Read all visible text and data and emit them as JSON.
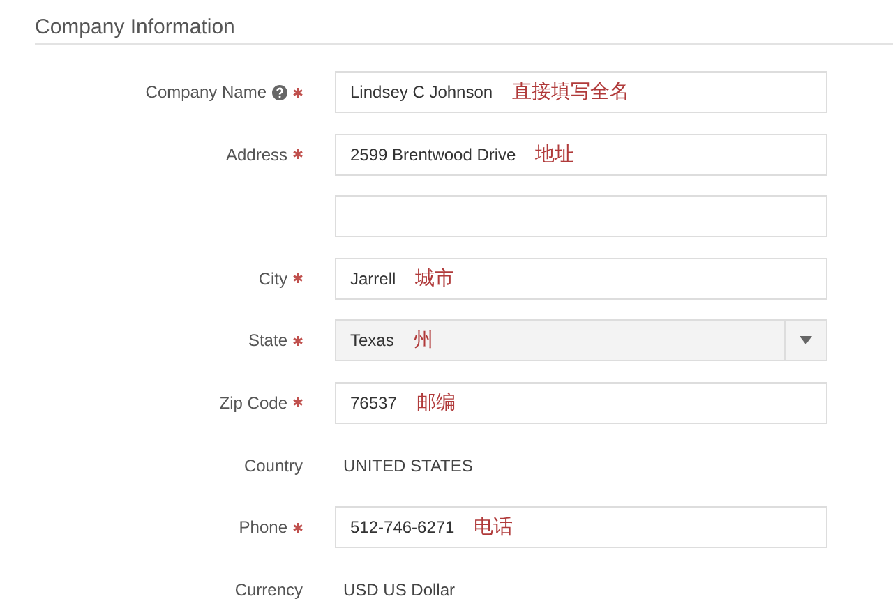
{
  "section": {
    "title": "Company Information"
  },
  "fields": [
    {
      "kind": "input",
      "label": "Company Name",
      "help": true,
      "required": true,
      "value": "Lindsey C Johnson",
      "annotation": "直接填写全名"
    },
    {
      "kind": "input",
      "label": "Address",
      "required": true,
      "value": "2599 Brentwood Drive",
      "annotation": "地址"
    },
    {
      "kind": "input"
    },
    {
      "kind": "input",
      "label": "City",
      "required": true,
      "value": "Jarrell",
      "annotation": "城市"
    },
    {
      "kind": "select",
      "label": "State",
      "required": true,
      "value": "Texas",
      "annotation": "州"
    },
    {
      "kind": "input",
      "label": "Zip Code",
      "required": true,
      "value": "76537",
      "annotation": "邮编"
    },
    {
      "kind": "text",
      "label": "Country",
      "value": "UNITED STATES"
    },
    {
      "kind": "input",
      "label": "Phone",
      "required": true,
      "value": "512-746-6271",
      "annotation": "电话"
    },
    {
      "kind": "text",
      "label": "Currency",
      "value": "USD US Dollar"
    }
  ]
}
